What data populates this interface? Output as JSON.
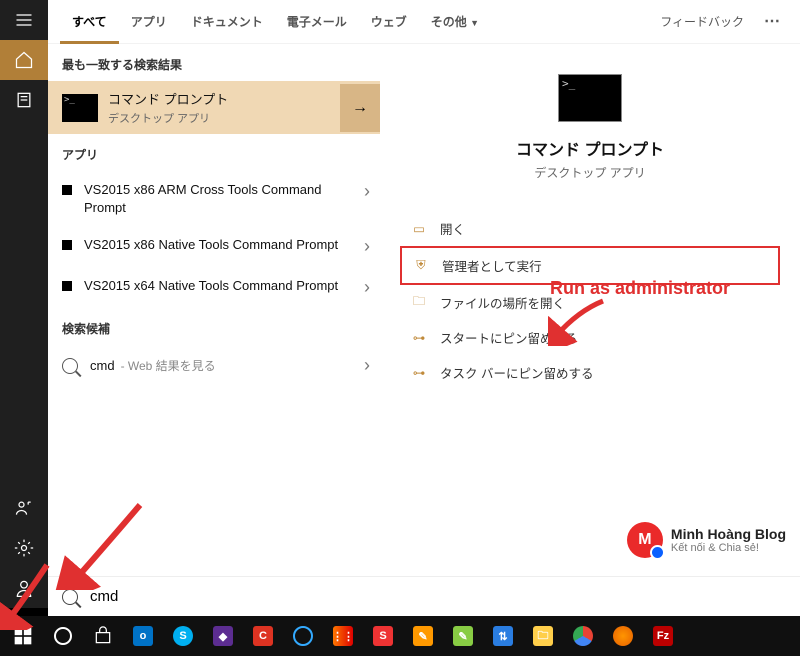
{
  "tabs": {
    "all": "すべて",
    "apps": "アプリ",
    "docs": "ドキュメント",
    "email": "電子メール",
    "web": "ウェブ",
    "more": "その他",
    "feedback": "フィードバック",
    "ellipsis": "⋯"
  },
  "sections": {
    "best": "最も一致する検索結果",
    "apps": "アプリ",
    "suggestions": "検索候補"
  },
  "bestMatch": {
    "title": "コマンド プロンプト",
    "sub": "デスクトップ アプリ"
  },
  "appResults": [
    {
      "title": "VS2015 x86 ARM Cross Tools Command Prompt"
    },
    {
      "title": "VS2015 x86 Native Tools Command Prompt"
    },
    {
      "title": "VS2015 x64 Native Tools Command Prompt"
    }
  ],
  "suggestion": {
    "term": "cmd",
    "hint": " - Web 結果を見る"
  },
  "preview": {
    "title": "コマンド プロンプト",
    "sub": "デスクトップ アプリ"
  },
  "actions": {
    "open": "開く",
    "runAdmin": "管理者として実行",
    "openLocation": "ファイルの場所を開く",
    "pinStart": "スタートにピン留めする",
    "pinTaskbar": "タスク バーにピン留めする"
  },
  "annotation": {
    "runAdmin": "Run as administrator"
  },
  "watermark": {
    "name": "Minh Hoàng Blog",
    "tagline": "Kết nối & Chia sẻ!"
  },
  "search": {
    "value": "cmd",
    "placeholder": ""
  },
  "taskbarIcons": [
    "start",
    "cortana",
    "store",
    "outlook",
    "skype",
    "vs",
    "ccleaner",
    "circle",
    "listary",
    "snagit",
    "screenpresso",
    "notepad",
    "winscp",
    "explorer",
    "chrome",
    "firefox",
    "filezilla"
  ]
}
